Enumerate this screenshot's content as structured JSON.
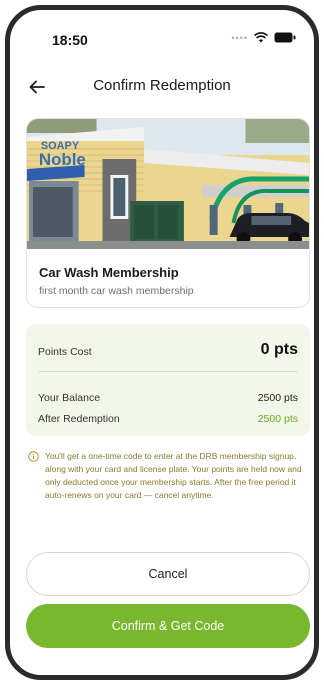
{
  "status": {
    "time": "18:50"
  },
  "header": {
    "title": "Confirm Redemption"
  },
  "reward": {
    "title": "Car Wash Membership",
    "description": "first month car wash membership",
    "image_sign_text": "SOAPY Noble"
  },
  "summary": {
    "points_cost_label": "Points Cost",
    "points_cost_value": "0 pts",
    "balance_label": "Your Balance",
    "balance_value": "2500 pts",
    "after_label": "After Redemption",
    "after_value": "2500 pts"
  },
  "note": {
    "text": "You'll get a one-time code to enter at the DRB membership signup, along with your card and license plate. Your points are held now and only deducted once your membership starts. After the free period it auto-renews on your card — cancel anytime."
  },
  "actions": {
    "cancel_label": "Cancel",
    "confirm_label": "Confirm & Get Code"
  },
  "colors": {
    "accent": "#78b72e",
    "accent_text": "#6aa724",
    "summary_bg": "#f3f7e9",
    "note_text": "#8a7a2b"
  },
  "icons": [
    "back-arrow-icon",
    "wifi-icon",
    "battery-icon",
    "info-icon"
  ]
}
